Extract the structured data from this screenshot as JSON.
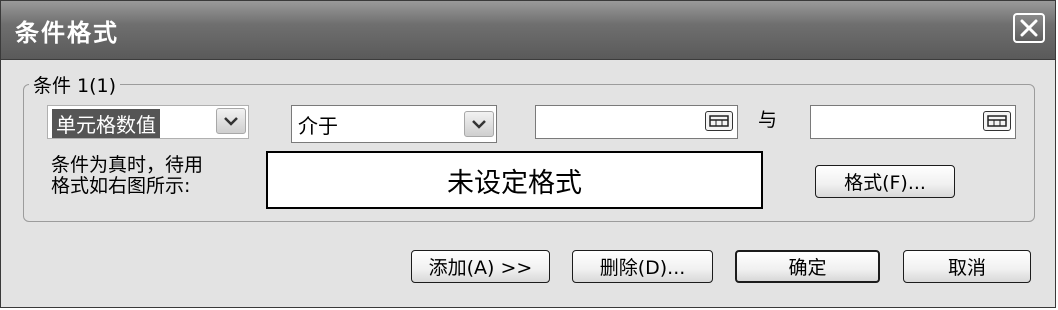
{
  "dialog": {
    "title": "条件格式",
    "close_label": "✕"
  },
  "condition": {
    "legend": "条件 1(1)",
    "type_value": "单元格数值",
    "operator_value": "介于",
    "value1": "",
    "and_label": "与",
    "value2": "",
    "preview_caption_line1": "条件为真时，待用",
    "preview_caption_line2": "格式如右图所示:",
    "preview_text": "未设定格式",
    "format_button": "格式(F)..."
  },
  "footer": {
    "add_button": "添加(A) >>",
    "delete_button": "删除(D)...",
    "ok_button": "确定",
    "cancel_button": "取消"
  },
  "icons": {
    "close": "close-icon",
    "dropdown": "chevron-down-icon",
    "range_picker": "collapse-dialog-icon"
  },
  "colors": {
    "title_bar": "#6f6f6f",
    "dialog_bg": "#e3e3e3",
    "selection": "#555555"
  }
}
